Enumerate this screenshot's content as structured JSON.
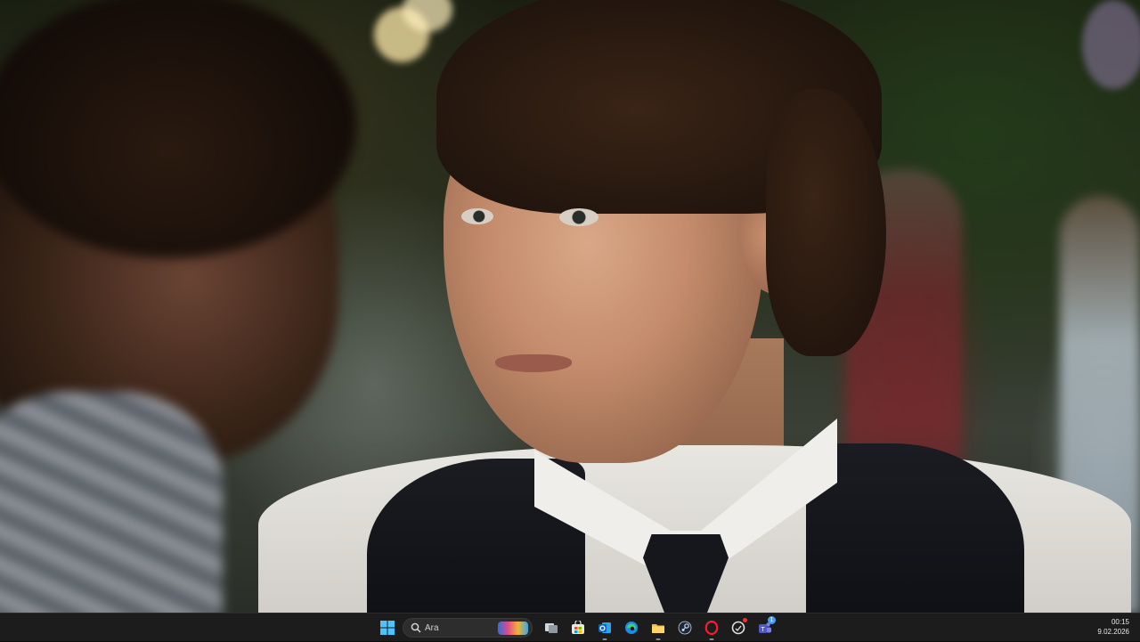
{
  "taskbar": {
    "search": {
      "label": "Ara",
      "icon": "search-icon"
    },
    "apps": [
      {
        "name": "start-icon"
      },
      {
        "name": "task-view-icon"
      },
      {
        "name": "microsoft-store-icon"
      },
      {
        "name": "outlook-icon"
      },
      {
        "name": "edge-icon"
      },
      {
        "name": "file-explorer-icon"
      },
      {
        "name": "steam-icon"
      },
      {
        "name": "opera-icon"
      },
      {
        "name": "app-with-notification-icon"
      },
      {
        "name": "teams-icon",
        "badge": "1"
      }
    ],
    "clock": {
      "time": "00:15",
      "date": "9.02.2026"
    }
  },
  "colors": {
    "taskbar_bg": "#1c1c1c",
    "accent": "#4a9ef0"
  }
}
